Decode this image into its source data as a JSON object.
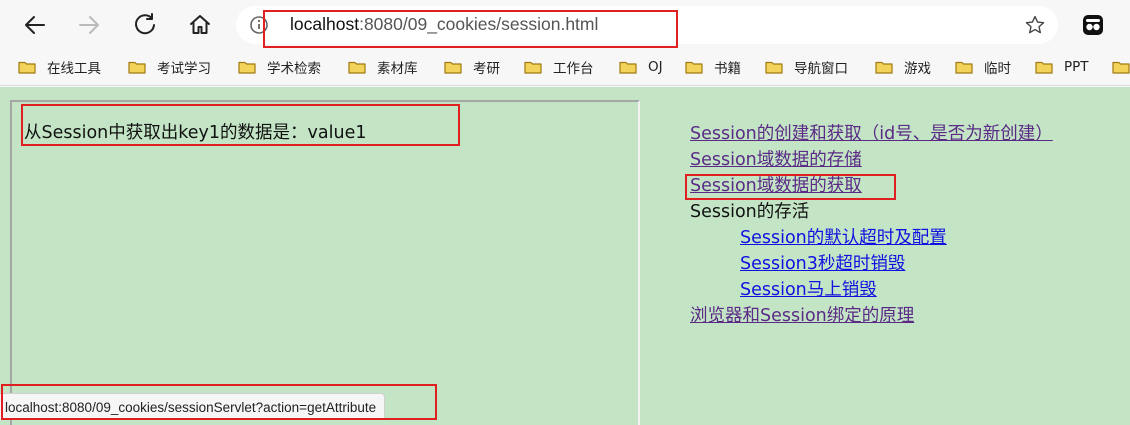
{
  "browser": {
    "url_host": "localhost",
    "url_rest": ":8080/09_cookies/session.html",
    "status_url": "localhost:8080/09_cookies/sessionServlet?action=getAttribute"
  },
  "bookmarks": [
    {
      "label": "在线工具"
    },
    {
      "label": "考试学习"
    },
    {
      "label": "学术检索"
    },
    {
      "label": "素材库"
    },
    {
      "label": "考研"
    },
    {
      "label": "工作台"
    },
    {
      "label": "OJ"
    },
    {
      "label": "书籍"
    },
    {
      "label": "导航窗口"
    },
    {
      "label": "游戏"
    },
    {
      "label": "临时"
    },
    {
      "label": "PPT"
    }
  ],
  "left_frame": {
    "result": "从Session中获取出key1的数据是：value1"
  },
  "nav": {
    "create": "Session的创建和获取（id号、是否为新创建）",
    "store": "Session域数据的存储",
    "get": "Session域数据的获取",
    "lifetime_heading": "Session的存活",
    "default_timeout": "Session的默认超时及配置",
    "three_sec": "Session3秒超时销毁",
    "destroy_now": "Session马上销毁",
    "principle": "浏览器和Session绑定的原理"
  },
  "colors": {
    "content_bg": "#c3e5c5",
    "visited_link": "#5a2a86",
    "link": "#1010e0",
    "highlight": "#e02020"
  }
}
